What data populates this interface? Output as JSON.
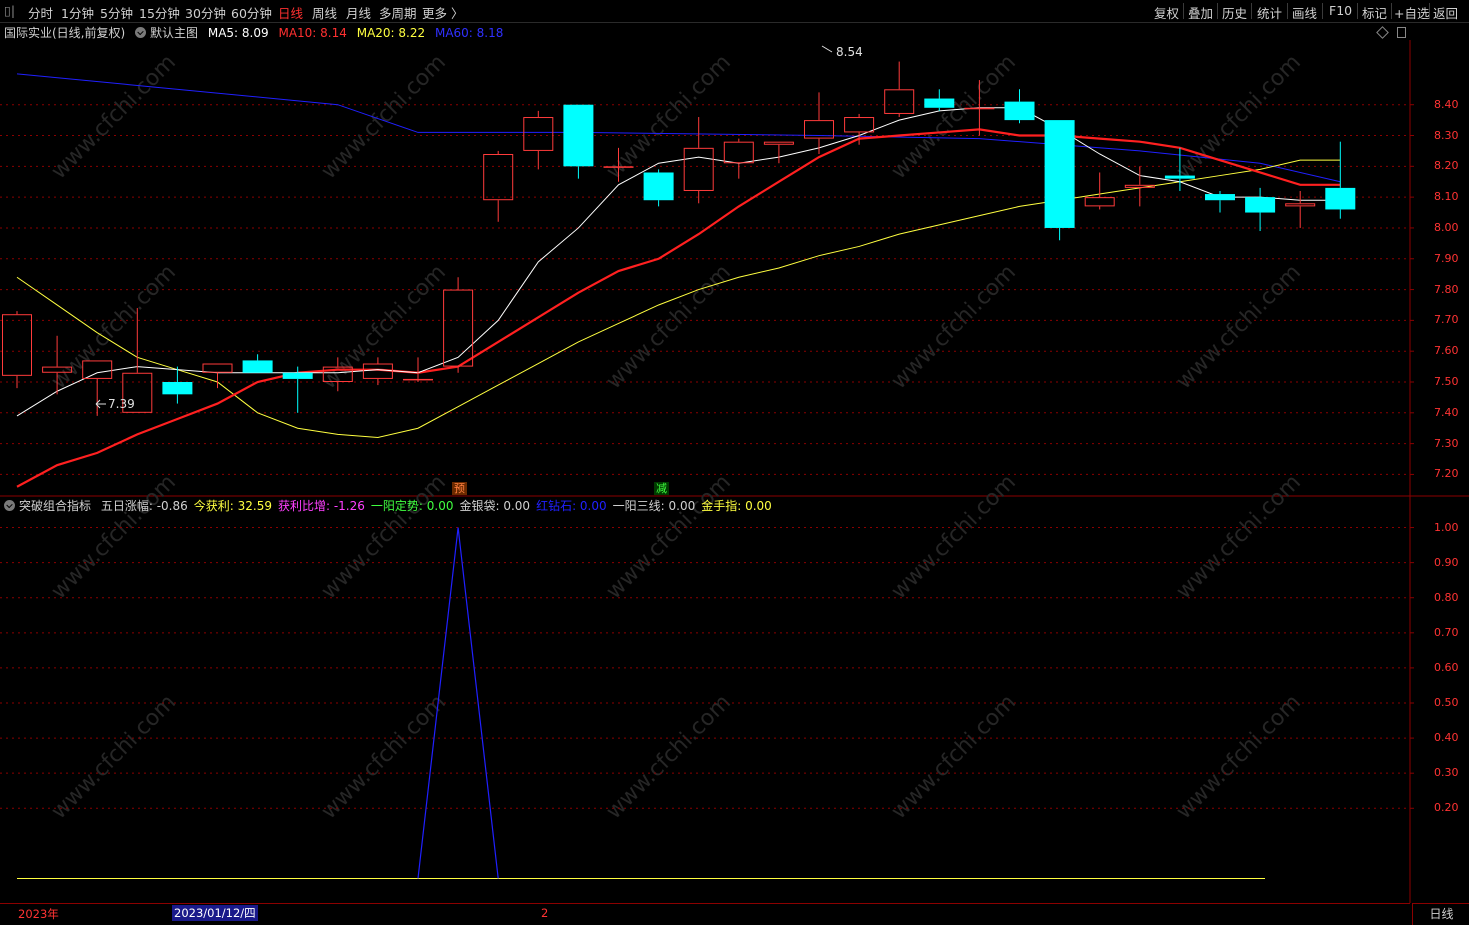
{
  "toolbar": {
    "left_icon": "▯|",
    "periods": [
      "分时",
      "1分钟",
      "5分钟",
      "15分钟",
      "30分钟",
      "60分钟",
      "日线",
      "周线",
      "月线",
      "多周期",
      "更多 〉"
    ],
    "active_period": "日线",
    "tools": [
      "复权",
      "叠加",
      "历史",
      "统计",
      "画线",
      "F10",
      "标记",
      "+自选",
      "返回"
    ]
  },
  "main_header": {
    "stock": "国际实业(日线,前复权)",
    "template": "默认主图",
    "ma5_label": "MA5: 8.09",
    "ma10_label": "MA10: 8.14",
    "ma20_label": "MA20: 8.22",
    "ma60_label": "MA60: 8.18"
  },
  "colors": {
    "up": "#ff3b3b",
    "down": "#00ffff",
    "ma5": "#ffffff",
    "ma10": "#ff2020",
    "ma20": "#ffff40",
    "ma60": "#2020ff",
    "grid": "#8b0000",
    "axis": "#ff3333"
  },
  "main_axis": [
    "8.40",
    "8.30",
    "8.20",
    "8.10",
    "8.00",
    "7.90",
    "7.80",
    "7.70",
    "7.60",
    "7.50",
    "7.40",
    "7.30",
    "7.20"
  ],
  "annotations": {
    "high": "8.54",
    "low": "7.39",
    "mark1": "预",
    "mark2": "减"
  },
  "ind_header": {
    "name": "突破组合指标",
    "items": [
      {
        "label": "五日涨幅: -0.86",
        "color": "#d0d0d0"
      },
      {
        "label": "今获利: 32.59",
        "color": "#ffff40"
      },
      {
        "label": "获利比增: -1.26",
        "color": "#ff40ff"
      },
      {
        "label": "一阳定势: 0.00",
        "color": "#40ff40"
      },
      {
        "label": "金银袋: 0.00",
        "color": "#d0d0d0"
      },
      {
        "label": "红钻石: 0.00",
        "color": "#2020ff"
      },
      {
        "label": "一阳三线: 0.00",
        "color": "#d0d0d0"
      },
      {
        "label": "金手指: 0.00",
        "color": "#ffff40"
      }
    ]
  },
  "ind_axis": [
    "1.00",
    "0.90",
    "0.80",
    "0.70",
    "0.60",
    "0.50",
    "0.40",
    "0.30",
    "0.20"
  ],
  "datebar": {
    "year": "2023年",
    "cursor_date": "2023/01/12/四",
    "mid": "2",
    "period": "日线"
  },
  "watermark": "www.cfchi.com",
  "chart_data": {
    "type": "candlestick",
    "ylim": [
      7.13,
      8.61
    ],
    "candles": [
      {
        "o": 7.52,
        "h": 7.73,
        "l": 7.48,
        "c": 7.72
      },
      {
        "o": 7.53,
        "h": 7.65,
        "l": 7.46,
        "c": 7.55
      },
      {
        "o": 7.51,
        "h": 7.57,
        "l": 7.39,
        "c": 7.57
      },
      {
        "o": 7.4,
        "h": 7.74,
        "l": 7.4,
        "c": 7.53
      },
      {
        "o": 7.5,
        "h": 7.55,
        "l": 7.43,
        "c": 7.46
      },
      {
        "o": 7.53,
        "h": 7.56,
        "l": 7.48,
        "c": 7.56
      },
      {
        "o": 7.57,
        "h": 7.59,
        "l": 7.53,
        "c": 7.53
      },
      {
        "o": 7.53,
        "h": 7.55,
        "l": 7.4,
        "c": 7.51
      },
      {
        "o": 7.5,
        "h": 7.58,
        "l": 7.47,
        "c": 7.55
      },
      {
        "o": 7.51,
        "h": 7.58,
        "l": 7.49,
        "c": 7.56
      },
      {
        "o": 7.51,
        "h": 7.58,
        "l": 7.5,
        "c": 7.51
      },
      {
        "o": 7.55,
        "h": 7.84,
        "l": 7.53,
        "c": 7.8
      },
      {
        "o": 8.09,
        "h": 8.25,
        "l": 8.02,
        "c": 8.24
      },
      {
        "o": 8.25,
        "h": 8.38,
        "l": 8.19,
        "c": 8.36
      },
      {
        "o": 8.4,
        "h": 8.4,
        "l": 8.16,
        "c": 8.2
      },
      {
        "o": 8.2,
        "h": 8.26,
        "l": 8.15,
        "c": 8.2
      },
      {
        "o": 8.18,
        "h": 8.19,
        "l": 8.07,
        "c": 8.09
      },
      {
        "o": 8.12,
        "h": 8.36,
        "l": 8.08,
        "c": 8.26
      },
      {
        "o": 8.21,
        "h": 8.29,
        "l": 8.16,
        "c": 8.28
      },
      {
        "o": 8.27,
        "h": 8.28,
        "l": 8.21,
        "c": 8.28
      },
      {
        "o": 8.29,
        "h": 8.44,
        "l": 8.24,
        "c": 8.35
      },
      {
        "o": 8.31,
        "h": 8.37,
        "l": 8.27,
        "c": 8.36
      },
      {
        "o": 8.37,
        "h": 8.54,
        "l": 8.36,
        "c": 8.45
      },
      {
        "o": 8.42,
        "h": 8.45,
        "l": 8.38,
        "c": 8.39
      },
      {
        "o": 8.39,
        "h": 8.48,
        "l": 8.3,
        "c": 8.39
      },
      {
        "o": 8.41,
        "h": 8.45,
        "l": 8.34,
        "c": 8.35
      },
      {
        "o": 8.35,
        "h": 8.35,
        "l": 7.96,
        "c": 8.0
      },
      {
        "o": 8.07,
        "h": 8.18,
        "l": 8.06,
        "c": 8.1
      },
      {
        "o": 8.13,
        "h": 8.2,
        "l": 8.07,
        "c": 8.14
      },
      {
        "o": 8.17,
        "h": 8.26,
        "l": 8.12,
        "c": 8.16
      },
      {
        "o": 8.11,
        "h": 8.12,
        "l": 8.05,
        "c": 8.09
      },
      {
        "o": 8.1,
        "h": 8.13,
        "l": 7.99,
        "c": 8.05
      },
      {
        "o": 8.07,
        "h": 8.12,
        "l": 8.0,
        "c": 8.08
      },
      {
        "o": 8.13,
        "h": 8.28,
        "l": 8.03,
        "c": 8.06
      }
    ],
    "ma5": [
      7.39,
      7.47,
      7.53,
      7.55,
      7.54,
      7.53,
      7.53,
      7.53,
      7.53,
      7.54,
      7.53,
      7.58,
      7.7,
      7.89,
      8.0,
      8.14,
      8.21,
      8.23,
      8.21,
      8.23,
      8.26,
      8.3,
      8.35,
      8.38,
      8.39,
      8.39,
      8.32,
      8.24,
      8.17,
      8.15,
      8.1,
      8.1,
      8.09,
      8.09
    ],
    "ma10": [
      7.16,
      7.23,
      7.27,
      7.33,
      7.38,
      7.43,
      7.5,
      7.53,
      7.54,
      7.54,
      7.53,
      7.55,
      7.63,
      7.71,
      7.79,
      7.86,
      7.9,
      7.98,
      8.07,
      8.15,
      8.23,
      8.29,
      8.3,
      8.31,
      8.32,
      8.3,
      8.3,
      8.29,
      8.28,
      8.26,
      8.22,
      8.18,
      8.14,
      8.14
    ],
    "ma20": [
      7.84,
      7.75,
      7.66,
      7.58,
      7.54,
      7.5,
      7.4,
      7.35,
      7.33,
      7.32,
      7.35,
      7.42,
      7.49,
      7.56,
      7.63,
      7.69,
      7.75,
      7.8,
      7.84,
      7.87,
      7.91,
      7.94,
      7.98,
      8.01,
      8.04,
      8.07,
      8.09,
      8.11,
      8.13,
      8.15,
      8.17,
      8.19,
      8.22,
      8.22
    ],
    "ma60_points": [
      [
        0,
        8.5
      ],
      [
        8,
        8.4
      ],
      [
        10,
        8.31
      ],
      [
        14,
        8.31
      ],
      [
        20,
        8.3
      ],
      [
        24,
        8.29
      ],
      [
        28,
        8.25
      ],
      [
        31,
        8.21
      ],
      [
        33,
        8.15
      ]
    ],
    "indicator": {
      "ylim": [
        -0.05,
        1.05
      ],
      "peak_index": 11,
      "values_nonzero": [
        {
          "i": 11,
          "v": 1.0
        }
      ]
    }
  }
}
